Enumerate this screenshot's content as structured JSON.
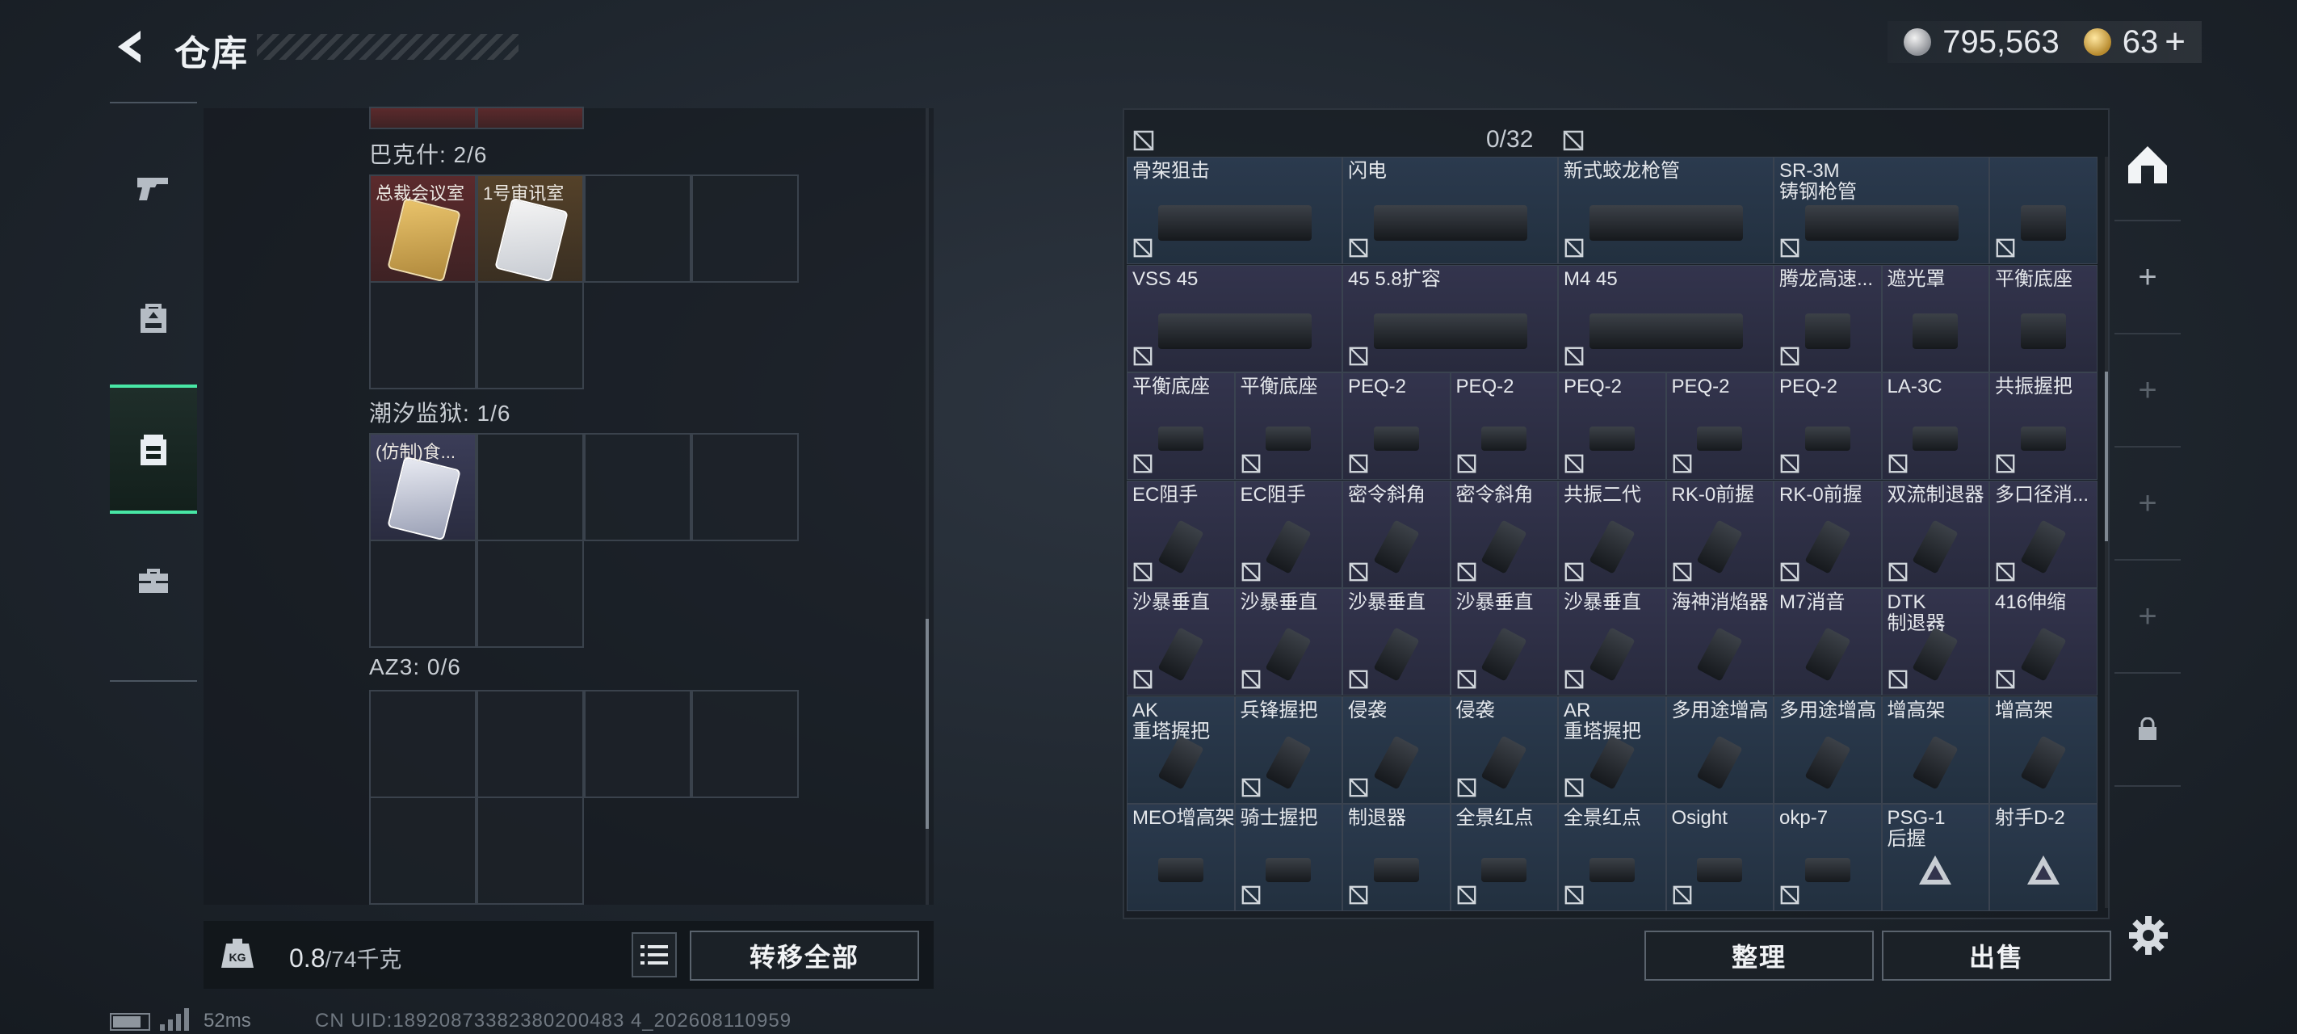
{
  "header": {
    "title": "仓库",
    "currency_silver": "795,563",
    "currency_gold": "63",
    "currency_plus": "+"
  },
  "side_tabs": [
    {
      "icon": "pistol-icon"
    },
    {
      "icon": "backpack-icon"
    },
    {
      "icon": "storage-icon",
      "active": true
    },
    {
      "icon": "toolbox-icon"
    }
  ],
  "storage_rooms": [
    {
      "label": "巴克什: 2/6",
      "cards": [
        {
          "name": "总裁会议室",
          "color": "gold"
        },
        {
          "name": "1号审讯室",
          "color": "white"
        }
      ]
    },
    {
      "label": "潮汐监狱: 1/6",
      "cards": [
        {
          "name": "(仿制)食...",
          "color": "silver"
        }
      ]
    },
    {
      "label": "AZ3: 0/6",
      "cards": []
    }
  ],
  "weight": {
    "current": "0.8",
    "max_text": "/74千克"
  },
  "buttons": {
    "transfer_all": "转移全部",
    "organize": "整理",
    "sell": "出售"
  },
  "capacity": "0/32",
  "grid_items": [
    [
      "骨架狙击",
      "闪电",
      "新式蛟龙枪管",
      "SR-3M\n铸钢枪管",
      ""
    ],
    [
      "VSS 45",
      "45 5.8扩容",
      "M4 45",
      "腾龙高速...",
      "遮光罩",
      "平衡底座"
    ],
    [
      "平衡底座",
      "平衡底座",
      "PEQ-2",
      "PEQ-2",
      "PEQ-2",
      "PEQ-2",
      "PEQ-2",
      "LA-3C",
      "共振握把"
    ],
    [
      "EC阻手",
      "EC阻手",
      "密令斜角",
      "密令斜角",
      "共振二代",
      "RK-0前握",
      "RK-0前握",
      "双流制退器",
      "多口径消..."
    ],
    [
      "沙暴垂直",
      "沙暴垂直",
      "沙暴垂直",
      "沙暴垂直",
      "沙暴垂直",
      "海神消焰器",
      "M7消音",
      "DTK\n制退器",
      "416伸缩"
    ],
    [
      "AK\n重塔握把",
      "兵锋握把",
      "侵袭",
      "侵袭",
      "AR\n重塔握把",
      "多用途增高",
      "多用途增高",
      "增高架",
      "增高架"
    ],
    [
      "MEO增高架",
      "骑士握把",
      "制退器",
      "全景红点",
      "全景红点",
      "Osight",
      "okp-7",
      "PSG-1\n后握",
      "射手D-2"
    ]
  ],
  "slot_column": [
    "home-icon",
    "+",
    "+",
    "+",
    "+",
    "lock-icon"
  ],
  "status": {
    "ping": "52ms",
    "uid": "CN UID:18920873382380200483 4_202608110959"
  }
}
